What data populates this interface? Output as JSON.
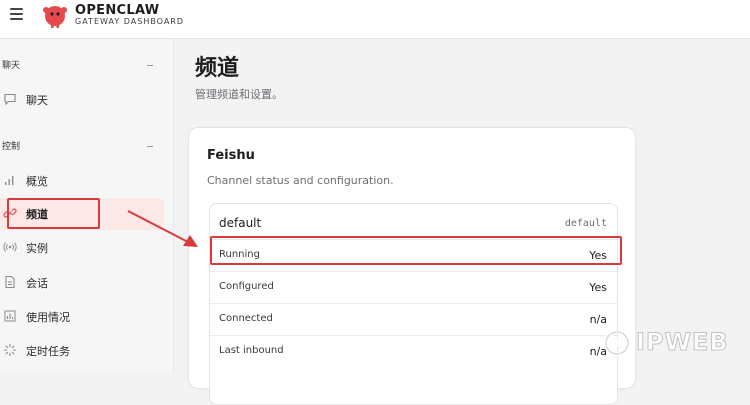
{
  "app": {
    "brand_title": "OPENCLAW",
    "brand_subtitle": "GATEWAY DASHBOARD",
    "accent_color": "#e5484d"
  },
  "sidebar": {
    "sections": [
      {
        "label": "聊天",
        "items": [
          {
            "label": "聊天",
            "icon": "chat-bubble-icon"
          }
        ]
      },
      {
        "label": "控制",
        "items": [
          {
            "label": "概览",
            "icon": "bar-chart-icon"
          },
          {
            "label": "频道",
            "icon": "link-icon",
            "active": true
          },
          {
            "label": "实例",
            "icon": "broadcast-icon"
          },
          {
            "label": "会话",
            "icon": "document-icon"
          },
          {
            "label": "使用情况",
            "icon": "chart-bars-icon"
          },
          {
            "label": "定时任务",
            "icon": "loader-icon"
          }
        ]
      }
    ]
  },
  "main": {
    "title": "频道",
    "subtitle": "管理频道和设置。",
    "card": {
      "title": "Feishu",
      "description": "Channel status and configuration.",
      "account": {
        "name": "default",
        "id": "default"
      },
      "rows": [
        {
          "key": "Running",
          "value": "Yes"
        },
        {
          "key": "Configured",
          "value": "Yes"
        },
        {
          "key": "Connected",
          "value": "n/a"
        },
        {
          "key": "Last inbound",
          "value": "n/a"
        }
      ]
    }
  },
  "watermark": {
    "text": "IPWEB"
  }
}
